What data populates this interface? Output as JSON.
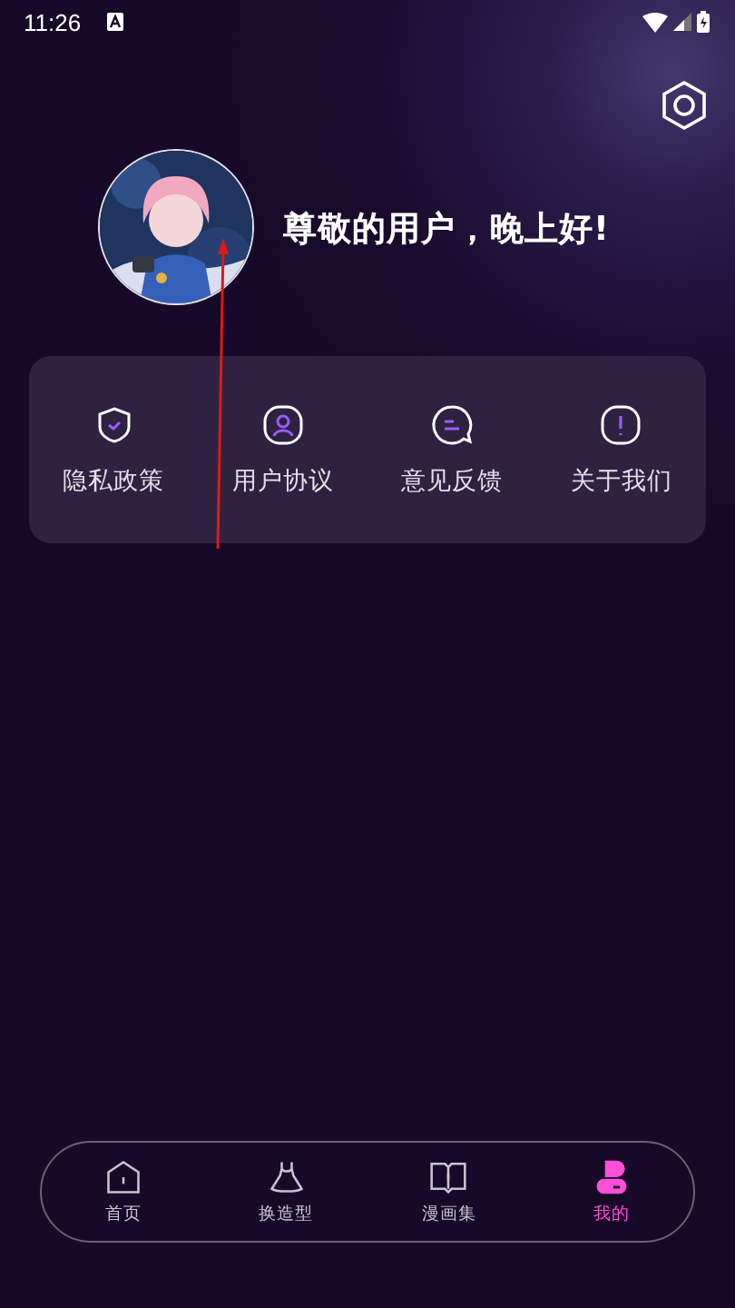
{
  "status_bar": {
    "time": "11:26"
  },
  "greeting": "尊敬的用户，晚上好!",
  "menu": [
    {
      "label": "隐私政策",
      "kind": "shield"
    },
    {
      "label": "用户协议",
      "kind": "user"
    },
    {
      "label": "意见反馈",
      "kind": "chat"
    },
    {
      "label": "关于我们",
      "kind": "info"
    }
  ],
  "nav": [
    {
      "label": "首页",
      "kind": "home",
      "selected": false
    },
    {
      "label": "换造型",
      "kind": "dress",
      "selected": false
    },
    {
      "label": "漫画集",
      "kind": "book",
      "selected": false
    },
    {
      "label": "我的",
      "kind": "profile",
      "selected": true
    }
  ]
}
